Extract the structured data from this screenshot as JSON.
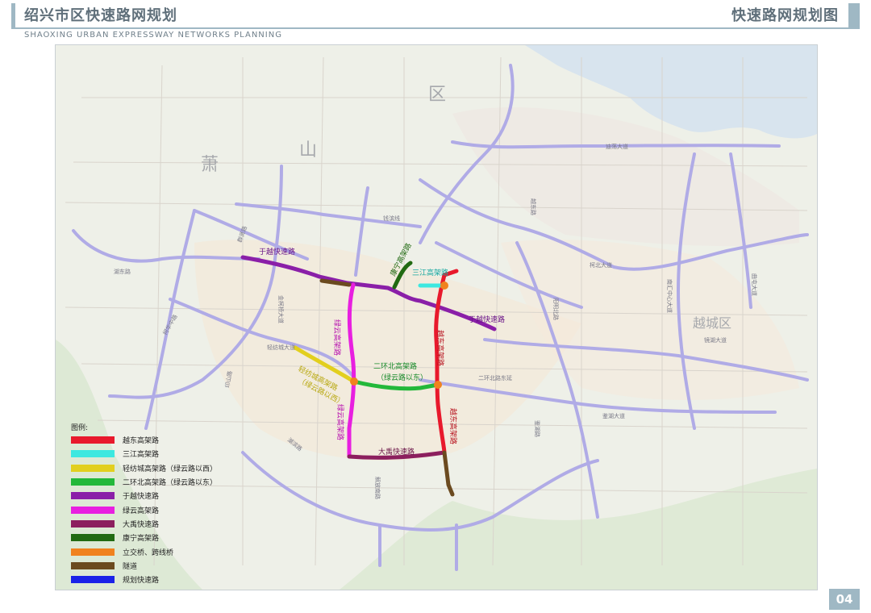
{
  "header": {
    "title": "绍兴市区快速路网规划",
    "subtitle": "SHAOXING URBAN EXPRESSWAY NETWORKS PLANNING",
    "section_title": "快速路网规划图",
    "page_number": "04"
  },
  "map": {
    "district_labels": [
      "萧",
      "山",
      "区",
      "越城区"
    ],
    "route_labels": {
      "yuyue_w": "于越快速路",
      "yuyue_e": "于越快速路",
      "kangning": "康宁高架路",
      "sanjiang": "三江高架路",
      "lvyun_n": "绿云高架路",
      "lvyun_s": "绿云高架路",
      "yuedong_n": "越东高架路",
      "yuedong_s": "越东高架路",
      "erhuan": "二环北高架路",
      "erhuan_note": "（绿云路以东）",
      "qingfang": "轻纺城高架路",
      "qingfang_note": "（绿云路以西）",
      "dayu": "大禹快速路"
    },
    "street_labels": [
      "钱滨线",
      "群贤路",
      "二环北路东延",
      "鉴湖大道",
      "镜湖大道",
      "阳明北路",
      "越东路",
      "迪荡大道",
      "南汇中心大道",
      "曲屯大道",
      "印山路",
      "湖滨路",
      "鉴湖路",
      "解放南路",
      "轻纺城大道",
      "湖东路",
      "柯华中路",
      "金柯桥大道",
      "柯北大道"
    ]
  },
  "legend": {
    "title": "图例:",
    "items": [
      {
        "label": "越东高架路",
        "color": "#e8192c"
      },
      {
        "label": "三江高架路",
        "color": "#3de8e0"
      },
      {
        "label": "轻纺城高架路（绿云路以西）",
        "color": "#e2cf1e"
      },
      {
        "label": "二环北高架路（绿云路以东）",
        "color": "#23b83a"
      },
      {
        "label": "于越快速路",
        "color": "#8a1fa8"
      },
      {
        "label": "绿云高架路",
        "color": "#e81fe0"
      },
      {
        "label": "大禹快速路",
        "color": "#8c1f5e"
      },
      {
        "label": "康宁高架路",
        "color": "#216a12"
      },
      {
        "label": "立交桥、跨线桥",
        "color": "#f0821e"
      },
      {
        "label": "隧道",
        "color": "#6b4a1f"
      },
      {
        "label": "规划快速路",
        "color": "#1b22e8"
      }
    ]
  }
}
